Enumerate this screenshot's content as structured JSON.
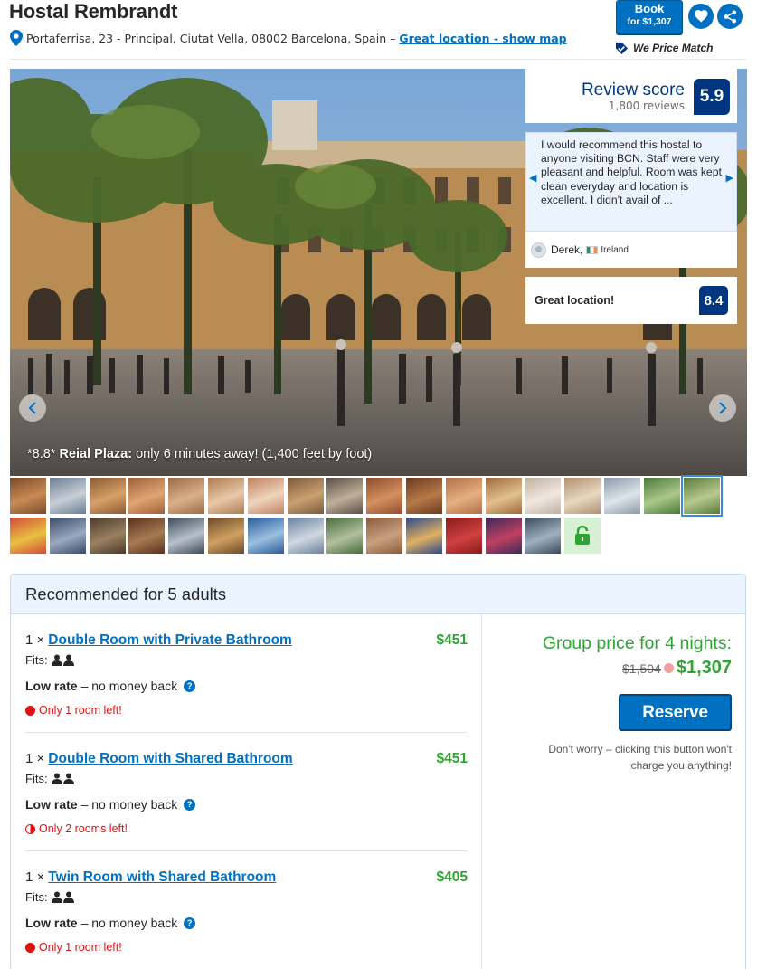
{
  "hotel": {
    "name": "Hostal Rembrandt",
    "address": "Portaferrisa, 23 - Principal, Ciutat Vella, 08002 Barcelona, Spain –",
    "location_link": "Great location - show map"
  },
  "actions": {
    "book_label": "Book",
    "book_price": "for $1,307",
    "price_match": "We Price Match",
    "icons": [
      "heart-icon",
      "share-icon",
      "price-match-icon"
    ]
  },
  "gallery": {
    "caption_score": "*8.8*",
    "caption_place": "Reial Plaza:",
    "caption_rest": "only 6 minutes away! (1,400 feet by foot)"
  },
  "review": {
    "score_label": "Review score",
    "count": "1,800 reviews",
    "score": "5.9",
    "quote": "I would recommend this hostal to anyone visiting BCN. Staff were very pleasant and helpful. Room was kept clean everyday and location is excellent. I didn't avail of ...",
    "reviewer": "Derek,",
    "country": "Ireland",
    "location_label": "Great location!",
    "location_score": "8.4"
  },
  "thumbnails": {
    "row1_count": 18,
    "row2_count": 15,
    "selected_index": 17
  },
  "recommended": {
    "title": "Recommended for 5 adults",
    "rooms": [
      {
        "qty": "1 ×",
        "name": "Double Room with Private Bathroom",
        "price": "$451",
        "fits": "Fits:",
        "rate": "Low rate",
        "rate_note": "– no money back",
        "availability": "Only 1 room left!"
      },
      {
        "qty": "1 ×",
        "name": "Double Room with Shared Bathroom",
        "price": "$451",
        "fits": "Fits:",
        "rate": "Low rate",
        "rate_note": "– no money back",
        "availability": "Only 2 rooms left!"
      },
      {
        "qty": "1 ×",
        "name": "Twin Room with Shared Bathroom",
        "price": "$405",
        "fits": "Fits:",
        "rate": "Low rate",
        "rate_note": "– no money back",
        "availability": "Only 1 room left!"
      }
    ],
    "group_price_label": "Group price for 4 nights:",
    "old_price": "$1,504",
    "new_price": "$1,307",
    "reserve_label": "Reserve",
    "note": "Don't worry – clicking this button won't charge you anything!"
  },
  "colors": {
    "brand_blue": "#0071c2",
    "dark_blue": "#003580",
    "price_green": "#2ca532",
    "alert_red": "#e21111",
    "panel_blue": "#ebf3ff"
  }
}
